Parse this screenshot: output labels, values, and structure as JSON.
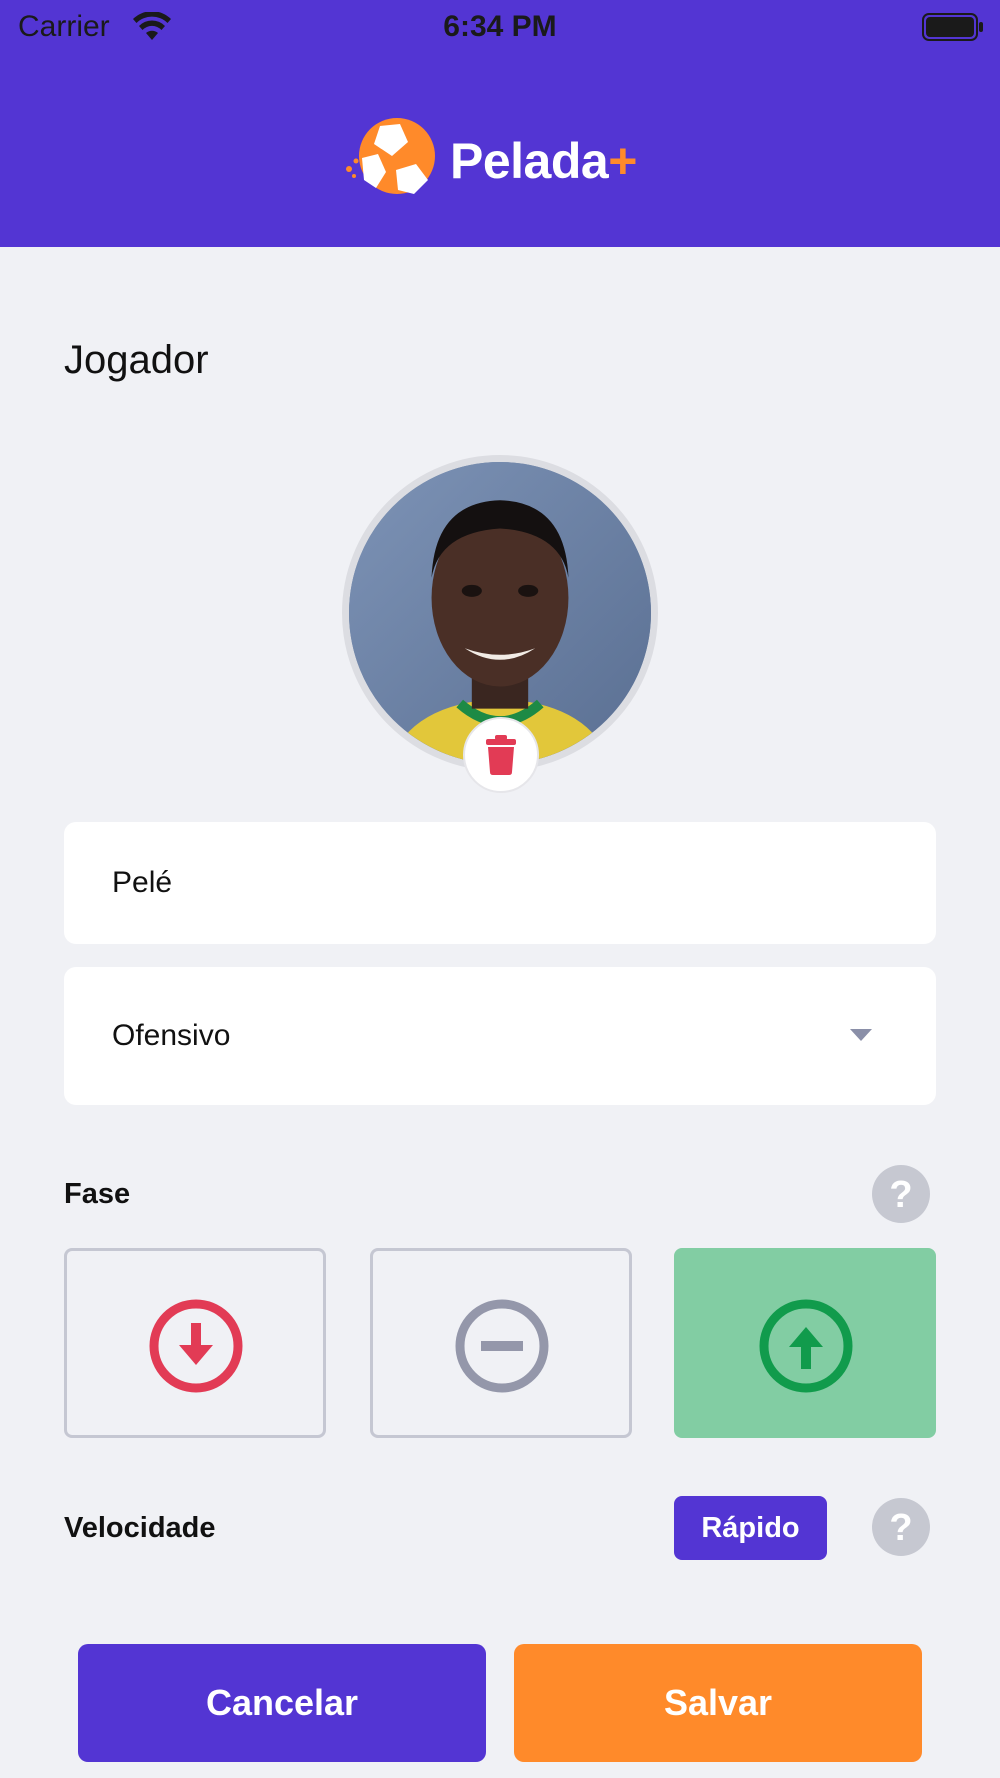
{
  "status_bar": {
    "carrier": "Carrier",
    "time": "6:34 PM"
  },
  "header": {
    "brand": "Pelada",
    "brand_plus": "+"
  },
  "page": {
    "title": "Jogador"
  },
  "player": {
    "photo_alt": "player-photo",
    "name": "Pelé",
    "position": "Ofensivo"
  },
  "phase": {
    "label": "Fase",
    "options": [
      {
        "id": "down",
        "icon": "arrow-down-circle-icon",
        "color": "#e23b55",
        "selected": false
      },
      {
        "id": "neutral",
        "icon": "minus-circle-icon",
        "color": "#9497aa",
        "selected": false
      },
      {
        "id": "up",
        "icon": "arrow-up-circle-icon",
        "color": "#119b4c",
        "selected": true
      }
    ]
  },
  "speed": {
    "label": "Velocidade",
    "value": "Rápido"
  },
  "actions": {
    "cancel": "Cancelar",
    "save": "Salvar"
  },
  "colors": {
    "primary": "#5335d3",
    "accent": "#ff8a2a",
    "danger": "#e23b55",
    "success": "#119b4c",
    "background": "#f0f1f5"
  }
}
